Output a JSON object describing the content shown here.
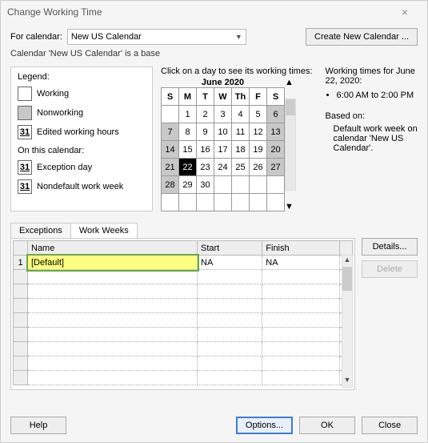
{
  "window": {
    "title": "Change Working Time"
  },
  "top": {
    "for_label": "For calendar:",
    "calendar_value": "New US Calendar",
    "create_btn": "Create New Calendar ...",
    "base_text": "Calendar 'New US Calendar' is a base"
  },
  "legend": {
    "title": "Legend:",
    "working": "Working",
    "nonworking": "Nonworking",
    "edited": "Edited working hours",
    "edited_num": "31",
    "oncal": "On this calendar:",
    "exception": "Exception day",
    "exception_num": "31",
    "nondefault": "Nondefault work week",
    "nondefault_num": "31"
  },
  "cal": {
    "click_hint": "Click on a day to see its working times:",
    "month": "June 2020",
    "dow": [
      "S",
      "M",
      "T",
      "W",
      "Th",
      "F",
      "S"
    ],
    "weeks": [
      [
        {
          "d": "",
          "c": ""
        },
        {
          "d": "1",
          "c": ""
        },
        {
          "d": "2",
          "c": ""
        },
        {
          "d": "3",
          "c": ""
        },
        {
          "d": "4",
          "c": ""
        },
        {
          "d": "5",
          "c": ""
        },
        {
          "d": "6",
          "c": "nonwork"
        }
      ],
      [
        {
          "d": "7",
          "c": "nonwork"
        },
        {
          "d": "8",
          "c": ""
        },
        {
          "d": "9",
          "c": ""
        },
        {
          "d": "10",
          "c": ""
        },
        {
          "d": "11",
          "c": ""
        },
        {
          "d": "12",
          "c": ""
        },
        {
          "d": "13",
          "c": "nonwork"
        }
      ],
      [
        {
          "d": "14",
          "c": "nonwork"
        },
        {
          "d": "15",
          "c": ""
        },
        {
          "d": "16",
          "c": ""
        },
        {
          "d": "17",
          "c": ""
        },
        {
          "d": "18",
          "c": ""
        },
        {
          "d": "19",
          "c": ""
        },
        {
          "d": "20",
          "c": "nonwork"
        }
      ],
      [
        {
          "d": "21",
          "c": "nonwork"
        },
        {
          "d": "22",
          "c": "selday"
        },
        {
          "d": "23",
          "c": ""
        },
        {
          "d": "24",
          "c": ""
        },
        {
          "d": "25",
          "c": ""
        },
        {
          "d": "26",
          "c": ""
        },
        {
          "d": "27",
          "c": "nonwork"
        }
      ],
      [
        {
          "d": "28",
          "c": "nonwork"
        },
        {
          "d": "29",
          "c": ""
        },
        {
          "d": "30",
          "c": ""
        },
        {
          "d": "",
          "c": ""
        },
        {
          "d": "",
          "c": ""
        },
        {
          "d": "",
          "c": ""
        },
        {
          "d": "",
          "c": ""
        }
      ],
      [
        {
          "d": "",
          "c": ""
        },
        {
          "d": "",
          "c": ""
        },
        {
          "d": "",
          "c": ""
        },
        {
          "d": "",
          "c": ""
        },
        {
          "d": "",
          "c": ""
        },
        {
          "d": "",
          "c": ""
        },
        {
          "d": "",
          "c": ""
        }
      ]
    ]
  },
  "right": {
    "header": "Working times for June 22, 2020:",
    "item1": "6:00 AM to 2:00 PM",
    "based_on": "Based on:",
    "based_text": "Default work week on calendar 'New US Calendar'."
  },
  "tabs": {
    "exceptions": "Exceptions",
    "workweeks": "Work Weeks"
  },
  "grid": {
    "cols": {
      "num": "",
      "name": "Name",
      "start": "Start",
      "finish": "Finish"
    },
    "row1": {
      "num": "1",
      "name": "[Default]",
      "start": "NA",
      "finish": "NA"
    }
  },
  "side": {
    "details": "Details...",
    "delete": "Delete"
  },
  "footer": {
    "help": "Help",
    "options": "Options...",
    "ok": "OK",
    "close": "Close"
  }
}
